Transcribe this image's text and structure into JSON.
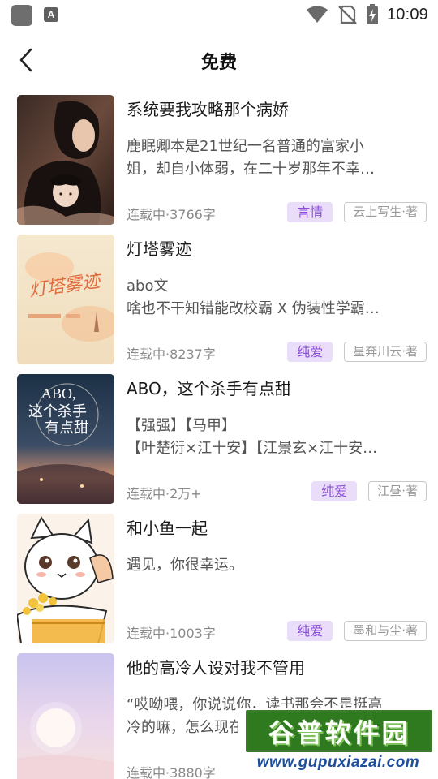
{
  "status_bar": {
    "app_icon_letter": "A",
    "time": "10:09",
    "icons": [
      "wifi-icon",
      "no-sim-icon",
      "battery-charging-icon"
    ]
  },
  "header": {
    "title": "免费",
    "back_icon": "chevron-left-icon"
  },
  "books": [
    {
      "title": "系统要我攻略那个病娇",
      "desc_lines": [
        "鹿眠卿本是21世纪一名普通的富家小",
        "姐，却自小体弱，在二十岁那年不幸…"
      ],
      "status": "连载中·3766字",
      "genre": "言情",
      "author": "云上写生·著"
    },
    {
      "title": "灯塔雾迹",
      "desc_lines": [
        "abo文",
        "啥也不干知错能改校霸 X 伪装性学霸…"
      ],
      "status": "连载中·8237字",
      "genre": "纯爱",
      "author": "星奔川云·著",
      "cover_text": "灯塔雾迹"
    },
    {
      "title": "ABO，这个杀手有点甜",
      "desc_lines": [
        "【强强】【马甲】",
        "【叶楚衍×江十安】【江景玄×江十安…"
      ],
      "status": "连载中·2万+",
      "genre": "纯爱",
      "author": "江昼·著",
      "cover_text_1": "ABO,",
      "cover_text_2": "这个杀手",
      "cover_text_3": "有点甜"
    },
    {
      "title": "和小鱼一起",
      "desc_lines": [
        "",
        "遇见，你很幸运。"
      ],
      "status": "连载中·1003字",
      "genre": "纯爱",
      "author": "墨和与尘·著"
    },
    {
      "title": "他的高冷人设对我不管用",
      "desc_lines": [
        "“哎呦喂，你说说你，读书那会不是挺高",
        "冷的嘛，怎么现在这样了？…"
      ],
      "status": "连载中·3880字",
      "genre": "纯爱",
      "author": ""
    }
  ],
  "watermark": {
    "brand": "谷普软件园",
    "url": "www.gupuxiazai.com"
  },
  "colors": {
    "genre_bg": "#e9ddfa",
    "genre_text": "#8a4fd3",
    "watermark_green": "#2f7a1f",
    "watermark_blue": "#1d4f9c"
  }
}
